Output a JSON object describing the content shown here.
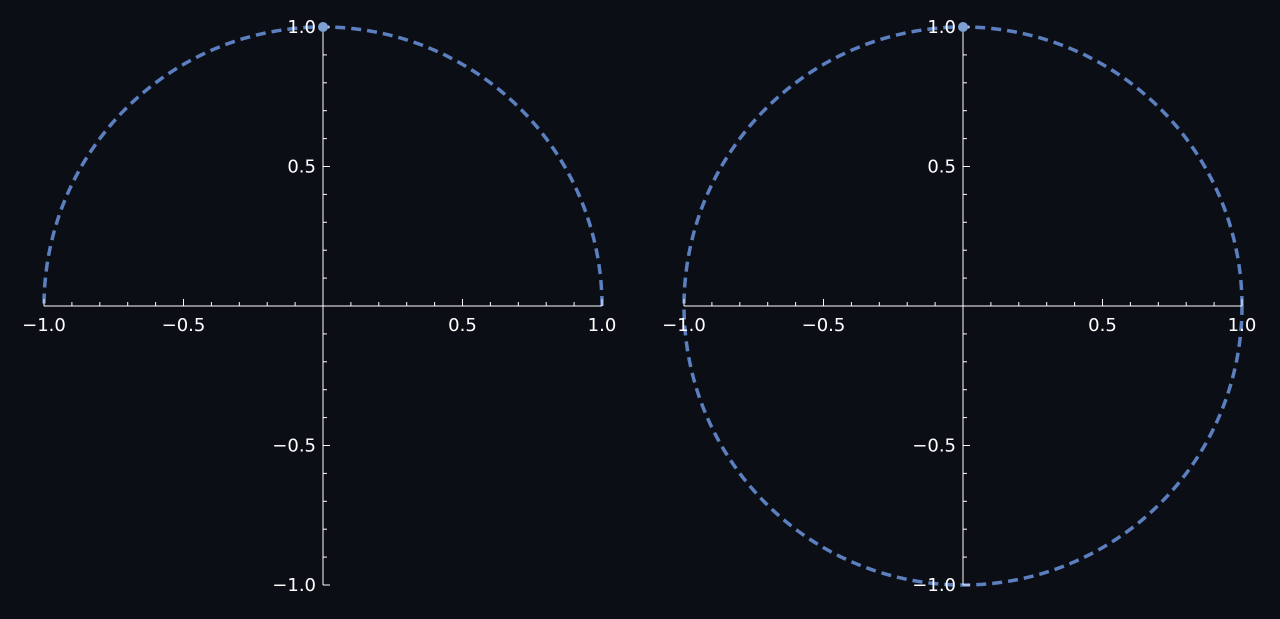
{
  "page": {
    "background": "#0b0e15"
  },
  "chart_data": [
    {
      "type": "line",
      "description": "Upper semicircle x^2 + y^2 = 1, y >= 0, drawn dashed",
      "title": "",
      "xlabel": "",
      "ylabel": "",
      "xlim": [
        -1.0,
        1.0
      ],
      "ylim": [
        -1.0,
        1.0
      ],
      "grid": false,
      "x_ticks": [
        "−1.0",
        "−0.5",
        "0.5",
        "1.0"
      ],
      "y_ticks": [
        "1.0",
        "0.5",
        "−0.5",
        "−1.0"
      ],
      "x_tick_values": [
        -1.0,
        -0.5,
        0.5,
        1.0
      ],
      "y_tick_values": [
        1.0,
        0.5,
        -0.5,
        -1.0
      ],
      "series": [
        {
          "color": "#5b7fbf",
          "style": "dashed",
          "theta_range_deg": [
            0,
            180
          ],
          "radius": 1.0
        }
      ],
      "marker": {
        "x": 0.0,
        "y": 1.0,
        "color": "#7fa0d4"
      }
    },
    {
      "type": "line",
      "description": "Full circle x^2 + y^2 = 1, drawn dashed",
      "title": "",
      "xlabel": "",
      "ylabel": "",
      "xlim": [
        -1.0,
        1.0
      ],
      "ylim": [
        -1.0,
        1.0
      ],
      "grid": false,
      "x_ticks": [
        "−1.0",
        "−0.5",
        "0.5",
        "1.0"
      ],
      "y_ticks": [
        "1.0",
        "0.5",
        "−0.5",
        "−1.0"
      ],
      "x_tick_values": [
        -1.0,
        -0.5,
        0.5,
        1.0
      ],
      "y_tick_values": [
        1.0,
        0.5,
        -0.5,
        -1.0
      ],
      "series": [
        {
          "color": "#5b7fbf",
          "style": "dashed",
          "theta_range_deg": [
            0,
            360
          ],
          "radius": 1.0
        }
      ],
      "marker": {
        "x": 0.0,
        "y": 1.0,
        "color": "#7fa0d4"
      }
    }
  ]
}
